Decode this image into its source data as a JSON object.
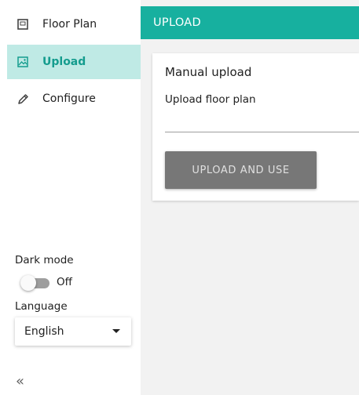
{
  "sidebar": {
    "items": [
      {
        "label": "Floor Plan",
        "icon": "floor-plan-icon",
        "active": false
      },
      {
        "label": "Upload",
        "icon": "image-icon",
        "active": true
      },
      {
        "label": "Configure",
        "icon": "pencil-icon",
        "active": false
      }
    ],
    "dark_mode": {
      "label": "Dark mode",
      "state": "Off",
      "enabled": false
    },
    "language": {
      "label": "Language",
      "selected": "English"
    },
    "collapse_glyph": "«"
  },
  "appbar": {
    "title": "UPLOAD"
  },
  "card": {
    "title": "Manual upload",
    "field_label": "Upload floor plan",
    "field_value": "",
    "button_label": "UPLOAD AND USE"
  },
  "colors": {
    "accent": "#17b09f",
    "active_bg": "#bfeae5",
    "active_text": "#149c8e",
    "main_bg": "#f2f2f2",
    "button_bg": "#777777"
  }
}
